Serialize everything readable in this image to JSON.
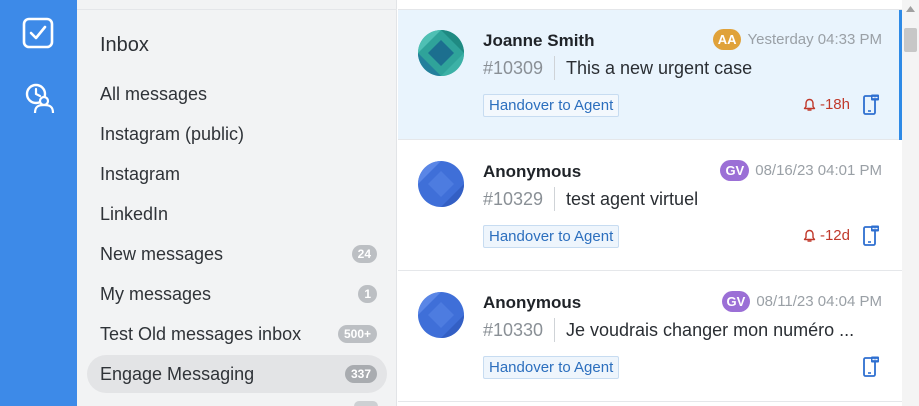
{
  "rail": {
    "items": [
      {
        "icon": "checkbox-icon",
        "label": ""
      },
      {
        "icon": "agent-icon",
        "label": ""
      }
    ]
  },
  "inbox": {
    "title": "Inbox",
    "folders": [
      {
        "label": "All messages",
        "count": ""
      },
      {
        "label": "Instagram (public)",
        "count": ""
      },
      {
        "label": "Instagram",
        "count": ""
      },
      {
        "label": "LinkedIn",
        "count": ""
      },
      {
        "label": "New messages",
        "count": "24"
      },
      {
        "label": "My messages",
        "count": "1"
      },
      {
        "label": "Test Old messages inbox",
        "count": "500+"
      },
      {
        "label": "Engage Messaging",
        "count": "337",
        "active": true
      }
    ]
  },
  "conversations": [
    {
      "name": "Joanne Smith",
      "agent_initials": "AA",
      "agent_color": "#e0a23a",
      "time": "Yesterday 04:33 PM",
      "case_id": "#10309",
      "subject": "This a new urgent case",
      "tag": "Handover to Agent",
      "sla": "-18h",
      "avatar_color": "#2fa39a",
      "selected": true
    },
    {
      "name": "Anonymous",
      "agent_initials": "GV",
      "agent_color": "#9b6fd6",
      "time": "08/16/23 04:01 PM",
      "case_id": "#10329",
      "subject": "test agent virtuel",
      "tag": "Handover to Agent",
      "sla": "-12d",
      "avatar_color": "#3f6fd8"
    },
    {
      "name": "Anonymous",
      "agent_initials": "GV",
      "agent_color": "#9b6fd6",
      "time": "08/11/23 04:04 PM",
      "case_id": "#10330",
      "subject": "Je voudrais changer mon numéro ...",
      "tag": "Handover to Agent",
      "sla": "",
      "avatar_color": "#3f6fd8"
    }
  ],
  "colors": {
    "rail": "#3d8ae8",
    "selected_row": "#e9f4fd",
    "accent": "#2e8ae6",
    "sla": "#c0392b",
    "tag_text": "#2c6fbe"
  }
}
